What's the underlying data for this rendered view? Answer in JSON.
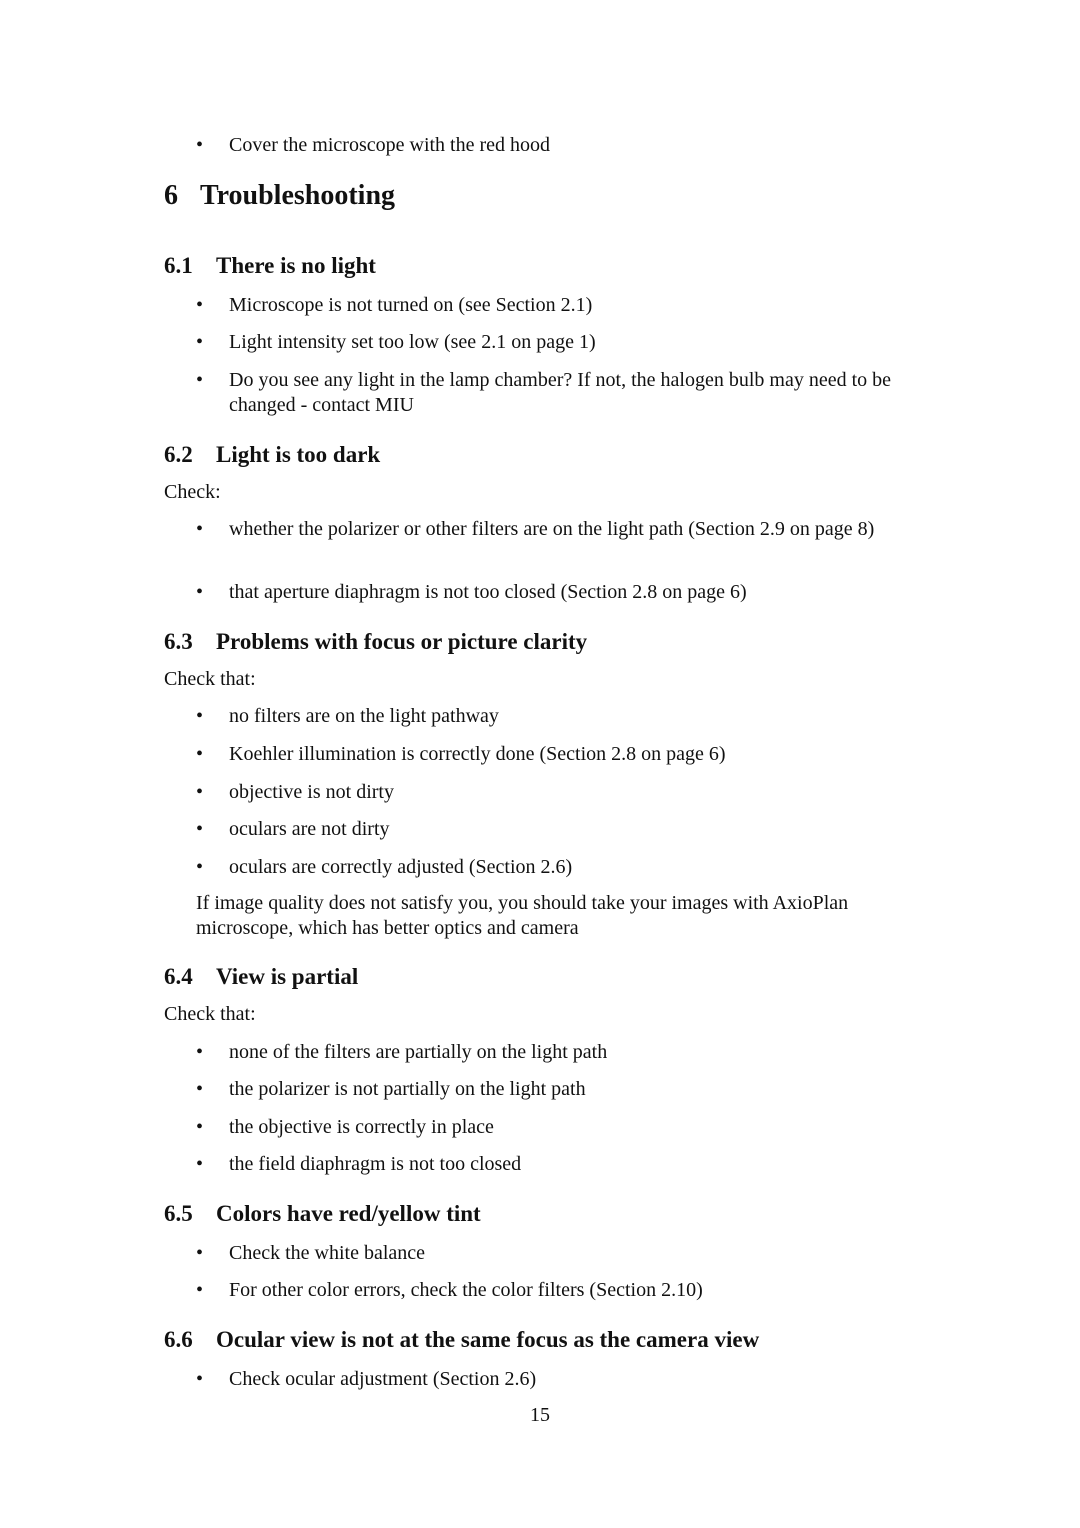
{
  "carryover_bullet": "Cover the microscope with the red hood",
  "chapter": {
    "number": "6",
    "title": "Troubleshooting"
  },
  "sections": [
    {
      "number": "6.1",
      "title": "There is no light",
      "intro": "",
      "bullets": [
        "Microscope is not turned on (see Section 2.1)",
        "Light intensity set too low (see 2.1 on page 1)",
        "Do you see any light in the lamp chamber? If not, the halogen bulb may need to be changed - contact MIU"
      ]
    },
    {
      "number": "6.2",
      "title": "Light is too dark",
      "intro": "Check:",
      "bullets": [
        "whether the polarizer or other filters are on the light path (Section 2.9 on page 8)",
        "that aperture diaphragm is not too closed (Section 2.8 on page 6)"
      ]
    },
    {
      "number": "6.3",
      "title": "Problems with focus or picture clarity",
      "intro": "Check that:",
      "bullets": [
        "no filters are on the light pathway",
        "Koehler illumination is correctly done (Section 2.8 on page 6)",
        "objective is not dirty",
        "oculars are not dirty",
        "oculars are correctly adjusted (Section 2.6)"
      ],
      "note": "If image quality does not satisfy you, you should take your images with AxioPlan microscope, which has better optics and camera"
    },
    {
      "number": "6.4",
      "title": "View is partial",
      "intro": "Check that:",
      "bullets": [
        "none of the filters are partially on the light path",
        "the polarizer is not partially on the light path",
        "the objective is correctly in place",
        "the field diaphragm is not too closed"
      ]
    },
    {
      "number": "6.5",
      "title": "Colors have red/yellow tint",
      "intro": "",
      "bullets": [
        "Check the white balance",
        "For other color errors, check the color filters (Section 2.10)"
      ]
    },
    {
      "number": "6.6",
      "title": "Ocular view is not at the same focus as the camera view",
      "intro": "",
      "bullets": [
        "Check ocular adjustment (Section 2.6)"
      ]
    }
  ],
  "bullet_glyph": "•",
  "page_number": "15"
}
